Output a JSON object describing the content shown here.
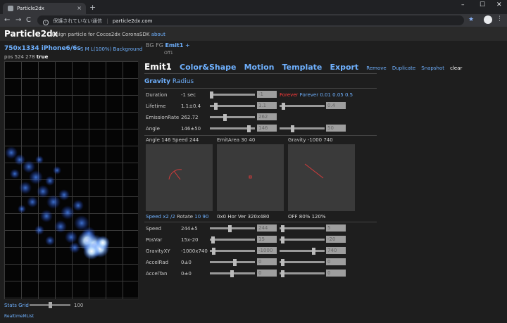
{
  "browser": {
    "tab_title": "Particle2dx",
    "tab_close": "×",
    "new_tab": "+",
    "win_min": "–",
    "win_max": "☐",
    "win_close": "✕",
    "back": "←",
    "forward": "→",
    "reload": "C",
    "security_text": "保護されていない通信",
    "url": "particle2dx.com",
    "star": "★",
    "menu": "⋮"
  },
  "app": {
    "title": "Particle2dx",
    "subtitle": "design particle for Cocos2dx CoronaSDK",
    "about": "about"
  },
  "left": {
    "resolution": "750x1334 iPhone6/6s",
    "size_options": "S M L(100%) Background",
    "pos_label": "pos 524 278",
    "pos_flag": "true",
    "stats_grid": "Stats Grid",
    "slider_value": "100",
    "realtime": "RealtimeMList"
  },
  "right": {
    "bg": "BG",
    "fg": "FG",
    "emit": "Emit1",
    "plus": "+",
    "off": "Off1",
    "tabs": [
      "Emit1",
      "Color&Shape",
      "Motion",
      "Template",
      "Export"
    ],
    "remove": "Remove",
    "duplicate": "Duplicate",
    "snapshot": "Snapshot",
    "clear": "clear",
    "gravity": "Gravity",
    "radius": "Radius"
  },
  "rows": {
    "duration": {
      "label": "Duration",
      "value": "-1 sec",
      "box1": "-1",
      "forever": "Forever",
      "forever2": "Forever",
      "q1": "0.01",
      "q2": "0.05",
      "q3": "0.5"
    },
    "lifetime": {
      "label": "Lifetime",
      "value": "1.1±0.4",
      "box1": "1.1",
      "box2": "0.4"
    },
    "emission": {
      "label": "EmissionRate",
      "value": "262.72",
      "box1": "262"
    },
    "angle": {
      "label": "Angle",
      "value": "146±50",
      "box1": "146",
      "box2": "50"
    },
    "speed": {
      "label": "Speed",
      "value": "244±5",
      "box1": "244",
      "box2": "5"
    },
    "posvar": {
      "label": "PosVar",
      "value": "15x-20",
      "box1": "15",
      "box2": "-20"
    },
    "gravityxy": {
      "label": "GravityXY",
      "value": "-1000x740",
      "box1": "-1000",
      "box2": "740"
    },
    "accelrad": {
      "label": "AccelRad",
      "value": "0±0",
      "box1": "0",
      "box2": "0"
    },
    "acceltan": {
      "label": "AccelTan",
      "value": "0±0",
      "box1": "0",
      "box2": "0"
    }
  },
  "panels": {
    "p1_label": "Angle 146 Speed 244",
    "p2_label": "EmitArea 30 40",
    "p3_label": "Gravity -1000 740",
    "p1_speed": "Speed",
    "p1_x": "x2",
    "p1_half": "/2",
    "p1_rotate": "Rotate",
    "p1_rot1": "10",
    "p1_rot2": "90",
    "p2_sub": "0x0 Hor Ver 320x480",
    "p3_sub": "OFF 80% 120%"
  },
  "colors": {
    "accent": "#6fb1ff",
    "red": "#ff3b3b",
    "panel": "#3a3a3a"
  }
}
